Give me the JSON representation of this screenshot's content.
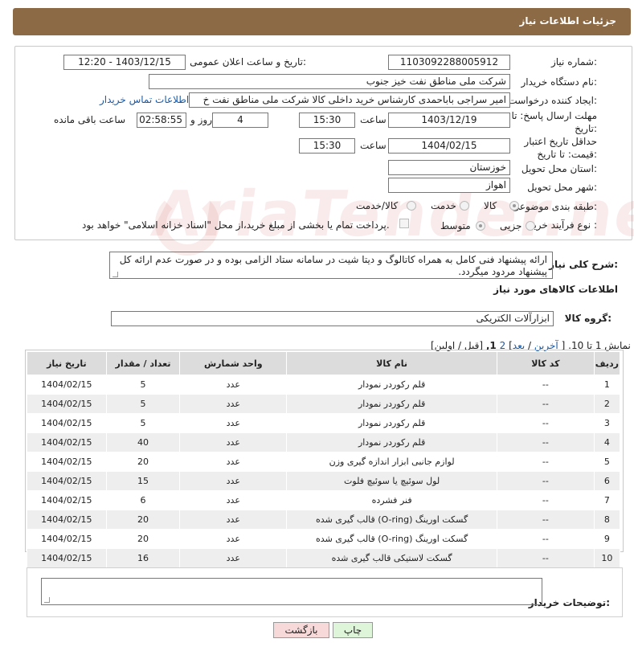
{
  "header": {
    "title": "جزئیات اطلاعات نیاز"
  },
  "form": {
    "need_number": {
      "label": "شماره نیاز:",
      "value": "1103092288005912"
    },
    "announce_datetime": {
      "label": "تاریخ و ساعت اعلان عمومی:",
      "value": "1403/12/15 - 12:20"
    },
    "buyer_org": {
      "label": "نام دستگاه خریدار:",
      "value": "شرکت ملی مناطق نفت خیز جنوب"
    },
    "requester": {
      "label": "ایجاد کننده درخواست:",
      "value": "امیر  سراجی باباحمدی  کارشناس خرید داخلی کالا شرکت ملی مناطق نفت خ",
      "contact_link": "اطلاعات تماس خریدار"
    },
    "reply_deadline": {
      "label": "مهلت ارسال پاسخ: تا تاریخ:",
      "date": "1403/12/19",
      "time_label": "ساعت",
      "time": "15:30",
      "days": "4",
      "days_label": "روز و",
      "remaining": "02:58:55",
      "remaining_label": "ساعت باقی مانده"
    },
    "price_validity": {
      "label": "حداقل تاریخ اعتبار قیمت: تا تاریخ:",
      "date": "1404/02/15",
      "time_label": "ساعت",
      "time": "15:30"
    },
    "province": {
      "label": "استان محل تحویل:",
      "value": "خوزستان"
    },
    "city": {
      "label": "شهر محل تحویل:",
      "value": "اهواز"
    },
    "category": {
      "label": "طبقه بندی موضوعی:",
      "options": [
        "کالا",
        "خدمت",
        "کالا/خدمت"
      ],
      "selected": "کالا"
    },
    "process": {
      "label": "نوع فرآیند خرید :",
      "options": [
        "جزیی",
        "متوسط"
      ],
      "selected": "متوسط",
      "payment_note": "پرداخت تمام یا بخشی از مبلغ خرید،از محل \"اسناد خزانه اسلامی\" خواهد بود."
    }
  },
  "description": {
    "label": "شرح کلی نیاز:",
    "text": "ارائه پیشنهاد فنی کامل به همراه کاتالوگ و دیتا شیت در سامانه ستاد الزامی بوده و در صورت عدم ارائه کل پیشنهاد مردود میگردد."
  },
  "goods_section": {
    "title": "اطلاعات کالاهای مورد نیاز",
    "group_label": "گروه کالا:",
    "group_value": "ابزارآلات الکتریکی"
  },
  "pagination": {
    "text_prefix": "نمایش 1 تا 10.",
    "open_bracket": "[",
    "last": "آخرین",
    "sep1": "/",
    "next": "بعد",
    "close_bracket1": "]",
    "page2": "2",
    "page1": "1,",
    "prev_first": "[قبل / اولین]"
  },
  "table": {
    "headers": [
      "ردیف",
      "کد کالا",
      "نام کالا",
      "واحد شمارش",
      "تعداد / مقدار",
      "تاریخ نیاز"
    ],
    "rows": [
      [
        "1",
        "--",
        "قلم رکوردر نمودار",
        "عدد",
        "5",
        "1404/02/15"
      ],
      [
        "2",
        "--",
        "قلم رکوردر نمودار",
        "عدد",
        "5",
        "1404/02/15"
      ],
      [
        "3",
        "--",
        "قلم رکوردر نمودار",
        "عدد",
        "5",
        "1404/02/15"
      ],
      [
        "4",
        "--",
        "قلم رکوردر نمودار",
        "عدد",
        "40",
        "1404/02/15"
      ],
      [
        "5",
        "--",
        "لوازم جانبی ابزار اندازه گیری وزن",
        "عدد",
        "20",
        "1404/02/15"
      ],
      [
        "6",
        "--",
        "لول سوئیچ یا سوئیچ فلوت",
        "عدد",
        "15",
        "1404/02/15"
      ],
      [
        "7",
        "--",
        "فنر فشرده",
        "عدد",
        "6",
        "1404/02/15"
      ],
      [
        "8",
        "--",
        "گسکت اورینگ (O-ring) قالب گیری شده",
        "عدد",
        "20",
        "1404/02/15"
      ],
      [
        "9",
        "--",
        "گسکت اورینگ (O-ring) قالب گیری شده",
        "عدد",
        "20",
        "1404/02/15"
      ],
      [
        "10",
        "--",
        "گسکت لاستیکی قالب گیری شده",
        "عدد",
        "16",
        "1404/02/15"
      ]
    ]
  },
  "buyer_notes": {
    "label": "توضیحات خریدار:",
    "value": ""
  },
  "buttons": {
    "print": "چاپ",
    "back": "بازگشت"
  },
  "watermark": "AriaTender.neT",
  "colors": {
    "header": "#8c6a45",
    "back_button": "#f7d9d9",
    "print_button": "#dff5d9"
  }
}
